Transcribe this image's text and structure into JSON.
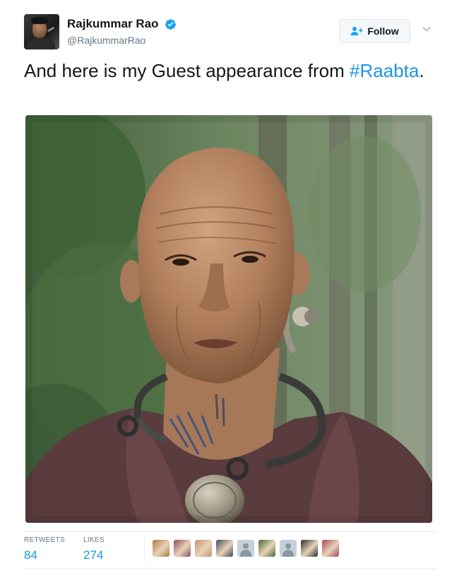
{
  "author": {
    "display_name": "Rajkummar Rao",
    "handle": "@RajkummarRao",
    "verified": true
  },
  "follow_button": {
    "label": "Follow"
  },
  "tweet": {
    "text_before": "And here is my Guest appearance from ",
    "hashtag": "#Raabta",
    "text_after": "."
  },
  "stats": {
    "retweets_label": "RETWEETS",
    "retweets_count": "84",
    "likes_label": "LIKES",
    "likes_count": "274"
  },
  "likers": [
    {
      "icon": "liker-avatar-1",
      "color": "#b07a3c"
    },
    {
      "icon": "liker-avatar-2",
      "color": "#8a5060"
    },
    {
      "icon": "liker-avatar-3",
      "color": "#c89070"
    },
    {
      "icon": "liker-avatar-4",
      "color": "#3a4a5a"
    },
    {
      "icon": "default-avatar",
      "color": "#c6d0d8"
    },
    {
      "icon": "liker-avatar-6",
      "color": "#4a6a30"
    },
    {
      "icon": "default-avatar",
      "color": "#c6d0d8"
    },
    {
      "icon": "liker-avatar-8",
      "color": "#2a2a2a"
    },
    {
      "icon": "liker-avatar-9",
      "color": "#a04858"
    }
  ],
  "colors": {
    "link": "#1b95e0",
    "verified": "#1da1f2",
    "text": "#14171a",
    "muted": "#657786"
  }
}
